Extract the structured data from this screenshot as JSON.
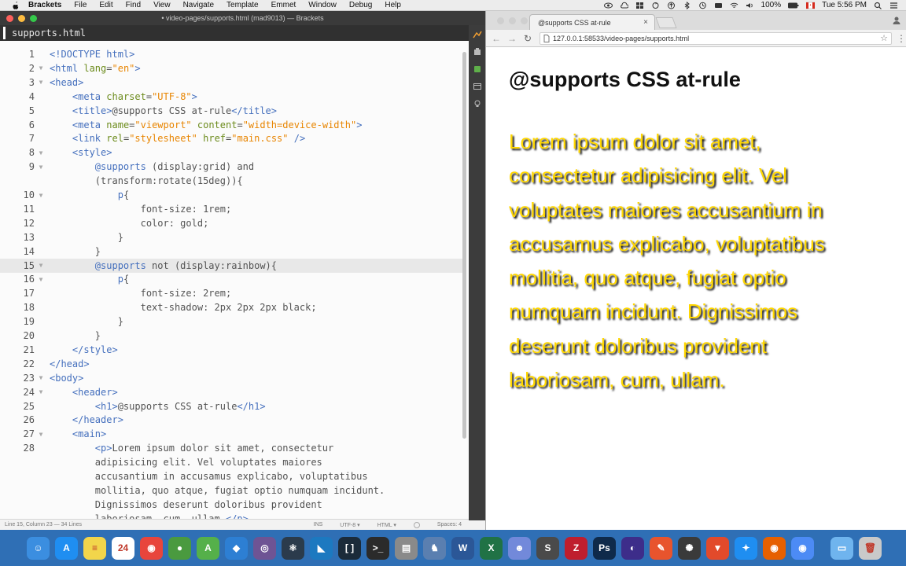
{
  "menubar": {
    "app_name": "Brackets",
    "items": [
      "File",
      "Edit",
      "Find",
      "View",
      "Navigate",
      "Template",
      "Emmet",
      "Window",
      "Debug",
      "Help"
    ],
    "battery": "100%",
    "clock": "Tue 5:56 PM"
  },
  "editor": {
    "window_title": "• video-pages/supports.html (mad9013) — Brackets",
    "file_tab": "supports.html",
    "lines": [
      {
        "n": "1",
        "fold": "",
        "segs": [
          [
            "c-tag",
            "<!DOCTYPE html>"
          ]
        ]
      },
      {
        "n": "2",
        "fold": "▼",
        "segs": [
          [
            "c-tag",
            "<html "
          ],
          [
            "c-attr",
            "lang"
          ],
          [
            "c-txt",
            "="
          ],
          [
            "c-str",
            "\"en\""
          ],
          [
            "c-tag",
            ">"
          ]
        ]
      },
      {
        "n": "3",
        "fold": "▼",
        "segs": [
          [
            "c-tag",
            "<head>"
          ]
        ]
      },
      {
        "n": "4",
        "fold": "",
        "segs": [
          [
            "c-txt",
            "    "
          ],
          [
            "c-tag",
            "<meta "
          ],
          [
            "c-attr",
            "charset"
          ],
          [
            "c-txt",
            "="
          ],
          [
            "c-str",
            "\"UTF-8\""
          ],
          [
            "c-tag",
            ">"
          ]
        ]
      },
      {
        "n": "5",
        "fold": "",
        "segs": [
          [
            "c-txt",
            "    "
          ],
          [
            "c-tag",
            "<title>"
          ],
          [
            "c-txt",
            "@supports CSS at-rule"
          ],
          [
            "c-tag",
            "</title>"
          ]
        ]
      },
      {
        "n": "6",
        "fold": "",
        "segs": [
          [
            "c-txt",
            "    "
          ],
          [
            "c-tag",
            "<meta "
          ],
          [
            "c-attr",
            "name"
          ],
          [
            "c-txt",
            "="
          ],
          [
            "c-str",
            "\"viewport\""
          ],
          [
            "c-attr",
            " content"
          ],
          [
            "c-txt",
            "="
          ],
          [
            "c-str",
            "\"width=device-width\""
          ],
          [
            "c-tag",
            ">"
          ]
        ]
      },
      {
        "n": "7",
        "fold": "",
        "segs": [
          [
            "c-txt",
            "    "
          ],
          [
            "c-tag",
            "<link "
          ],
          [
            "c-attr",
            "rel"
          ],
          [
            "c-txt",
            "="
          ],
          [
            "c-str",
            "\"stylesheet\""
          ],
          [
            "c-attr",
            " href"
          ],
          [
            "c-txt",
            "="
          ],
          [
            "c-str",
            "\"main.css\""
          ],
          [
            "c-tag",
            " />"
          ]
        ]
      },
      {
        "n": "8",
        "fold": "▼",
        "segs": [
          [
            "c-txt",
            "    "
          ],
          [
            "c-tag",
            "<style>"
          ]
        ]
      },
      {
        "n": "9",
        "fold": "▼",
        "segs": [
          [
            "c-txt",
            "        "
          ],
          [
            "c-kw",
            "@supports"
          ],
          [
            "c-txt",
            " (display:grid) and"
          ]
        ]
      },
      {
        "n": "",
        "fold": "",
        "segs": [
          [
            "c-txt",
            "        (transform:rotate(15deg)){"
          ]
        ]
      },
      {
        "n": "10",
        "fold": "▼",
        "segs": [
          [
            "c-txt",
            "            "
          ],
          [
            "c-sel",
            "p"
          ],
          [
            "c-txt",
            "{"
          ]
        ]
      },
      {
        "n": "11",
        "fold": "",
        "segs": [
          [
            "c-txt",
            "                "
          ],
          [
            "c-prop",
            "font-size: 1rem;"
          ]
        ]
      },
      {
        "n": "12",
        "fold": "",
        "segs": [
          [
            "c-txt",
            "                "
          ],
          [
            "c-prop",
            "color: gold;"
          ]
        ]
      },
      {
        "n": "13",
        "fold": "",
        "segs": [
          [
            "c-txt",
            "            }"
          ]
        ]
      },
      {
        "n": "14",
        "fold": "",
        "segs": [
          [
            "c-txt",
            "        }"
          ]
        ]
      },
      {
        "n": "15",
        "fold": "▼",
        "segs": [
          [
            "c-txt",
            "        "
          ],
          [
            "c-kw",
            "@supports"
          ],
          [
            "c-txt",
            " not (display:rainbow){"
          ]
        ]
      },
      {
        "n": "16",
        "fold": "▼",
        "segs": [
          [
            "c-txt",
            "            "
          ],
          [
            "c-sel",
            "p"
          ],
          [
            "c-txt",
            "{"
          ]
        ]
      },
      {
        "n": "17",
        "fold": "",
        "segs": [
          [
            "c-txt",
            "                "
          ],
          [
            "c-prop",
            "font-size: 2rem;"
          ]
        ]
      },
      {
        "n": "18",
        "fold": "",
        "segs": [
          [
            "c-txt",
            "                "
          ],
          [
            "c-prop",
            "text-shadow: 2px 2px 2px black;"
          ]
        ]
      },
      {
        "n": "19",
        "fold": "",
        "segs": [
          [
            "c-txt",
            "            }"
          ]
        ]
      },
      {
        "n": "20",
        "fold": "",
        "segs": [
          [
            "c-txt",
            "        }"
          ]
        ]
      },
      {
        "n": "21",
        "fold": "",
        "segs": [
          [
            "c-txt",
            "    "
          ],
          [
            "c-tag",
            "</style>"
          ]
        ]
      },
      {
        "n": "22",
        "fold": "",
        "segs": [
          [
            "c-tag",
            "</head>"
          ]
        ]
      },
      {
        "n": "23",
        "fold": "▼",
        "segs": [
          [
            "c-tag",
            "<body>"
          ]
        ]
      },
      {
        "n": "24",
        "fold": "▼",
        "segs": [
          [
            "c-txt",
            "    "
          ],
          [
            "c-tag",
            "<header>"
          ]
        ]
      },
      {
        "n": "25",
        "fold": "",
        "segs": [
          [
            "c-txt",
            "        "
          ],
          [
            "c-tag",
            "<h1>"
          ],
          [
            "c-txt",
            "@supports CSS at-rule"
          ],
          [
            "c-tag",
            "</h1>"
          ]
        ]
      },
      {
        "n": "26",
        "fold": "",
        "segs": [
          [
            "c-txt",
            "    "
          ],
          [
            "c-tag",
            "</header>"
          ]
        ]
      },
      {
        "n": "27",
        "fold": "▼",
        "segs": [
          [
            "c-txt",
            "    "
          ],
          [
            "c-tag",
            "<main>"
          ]
        ]
      },
      {
        "n": "28",
        "fold": "",
        "segs": [
          [
            "c-txt",
            "        "
          ],
          [
            "c-tag",
            "<p>"
          ],
          [
            "c-txt",
            "Lorem ipsum dolor sit amet, consectetur"
          ]
        ]
      },
      {
        "n": "",
        "fold": "",
        "segs": [
          [
            "c-txt",
            "        adipisicing elit. Vel voluptates maiores"
          ]
        ]
      },
      {
        "n": "",
        "fold": "",
        "segs": [
          [
            "c-txt",
            "        accusantium in accusamus explicabo, voluptatibus"
          ]
        ]
      },
      {
        "n": "",
        "fold": "",
        "segs": [
          [
            "c-txt",
            "        mollitia, quo atque, fugiat optio numquam incidunt."
          ]
        ]
      },
      {
        "n": "",
        "fold": "",
        "segs": [
          [
            "c-txt",
            "        Dignissimos deserunt doloribus provident"
          ]
        ]
      },
      {
        "n": "",
        "fold": "",
        "segs": [
          [
            "c-txt",
            "        laboriosam, cum, ullam."
          ],
          [
            "c-tag",
            "</p>"
          ]
        ]
      }
    ],
    "status": {
      "cursor": "Line 15, Column 23 — 34 Lines",
      "mode": "INS",
      "encoding": "UTF-8 ▾",
      "language": "HTML ▾",
      "spaces": "Spaces: 4"
    }
  },
  "browser": {
    "tab_title": "@supports CSS at-rule",
    "tab_close": "×",
    "url": "127.0.0.1:58533/video-pages/supports.html",
    "page": {
      "heading": "@supports CSS at-rule",
      "paragraph": "Lorem ipsum dolor sit amet, consectetur adipisicing elit. Vel voluptates maiores accusantium in accusamus explicabo, voluptatibus mollitia, quo atque, fugiat optio numquam incidunt. Dignissimos deserunt doloribus provident laboriosam, cum, ullam."
    }
  },
  "dock": {
    "icons": [
      {
        "name": "finder-icon",
        "color": "#3b8ee0",
        "glyph": "☺"
      },
      {
        "name": "app-store-icon",
        "color": "#1f8ef1",
        "glyph": "A"
      },
      {
        "name": "notes-icon",
        "color": "#f2d54b",
        "glyph": "≡"
      },
      {
        "name": "calendar-icon",
        "color": "#ffffff",
        "glyph": "24"
      },
      {
        "name": "chrome-icon",
        "color": "#e8453c",
        "glyph": "◉"
      },
      {
        "name": "mongodb-icon",
        "color": "#4a9a3f",
        "glyph": "●"
      },
      {
        "name": "leaf-app-icon",
        "color": "#55b04a",
        "glyph": "A"
      },
      {
        "name": "sourcetree-icon",
        "color": "#2d7fd3",
        "glyph": "◆"
      },
      {
        "name": "github-icon",
        "color": "#6e5494",
        "glyph": "◎"
      },
      {
        "name": "atom-icon",
        "color": "#2b3b4c",
        "glyph": "⚛"
      },
      {
        "name": "vscode-icon",
        "color": "#1c79c0",
        "glyph": "◣"
      },
      {
        "name": "brackets-icon",
        "color": "#1b2b3a",
        "glyph": "[ ]"
      },
      {
        "name": "terminal-icon",
        "color": "#2b2b2b",
        "glyph": ">_"
      },
      {
        "name": "archive-icon",
        "color": "#8a8a8a",
        "glyph": "▤"
      },
      {
        "name": "elephant-icon",
        "color": "#5a7fb0",
        "glyph": "♞"
      },
      {
        "name": "word-icon",
        "color": "#2b5797",
        "glyph": "W"
      },
      {
        "name": "excel-icon",
        "color": "#207245",
        "glyph": "X"
      },
      {
        "name": "discord-icon",
        "color": "#7289da",
        "glyph": "☻"
      },
      {
        "name": "sublime-icon",
        "color": "#4a4a4a",
        "glyph": "S"
      },
      {
        "name": "filezilla-icon",
        "color": "#bf1e2e",
        "glyph": "Z"
      },
      {
        "name": "photoshop-icon",
        "color": "#0f2a4a",
        "glyph": "Ps"
      },
      {
        "name": "eclipse-icon",
        "color": "#3d2d8a",
        "glyph": "◐"
      },
      {
        "name": "pen-tool-icon",
        "color": "#e8542d",
        "glyph": "✎"
      },
      {
        "name": "aperture-icon",
        "color": "#3a3a3a",
        "glyph": "✺"
      },
      {
        "name": "brave-icon",
        "color": "#e24a2b",
        "glyph": "▼"
      },
      {
        "name": "safari-icon",
        "color": "#1f8ef1",
        "glyph": "✦"
      },
      {
        "name": "firefox-icon",
        "color": "#e66000",
        "glyph": "◉"
      },
      {
        "name": "chrome-dock-icon",
        "color": "#4c8bf5",
        "glyph": "◉"
      },
      {
        "name": "downloads-folder-icon",
        "color": "#6fb4ee",
        "glyph": "▭"
      },
      {
        "name": "trash-icon",
        "color": "#c9c9c9",
        "glyph": "🗑"
      }
    ]
  }
}
